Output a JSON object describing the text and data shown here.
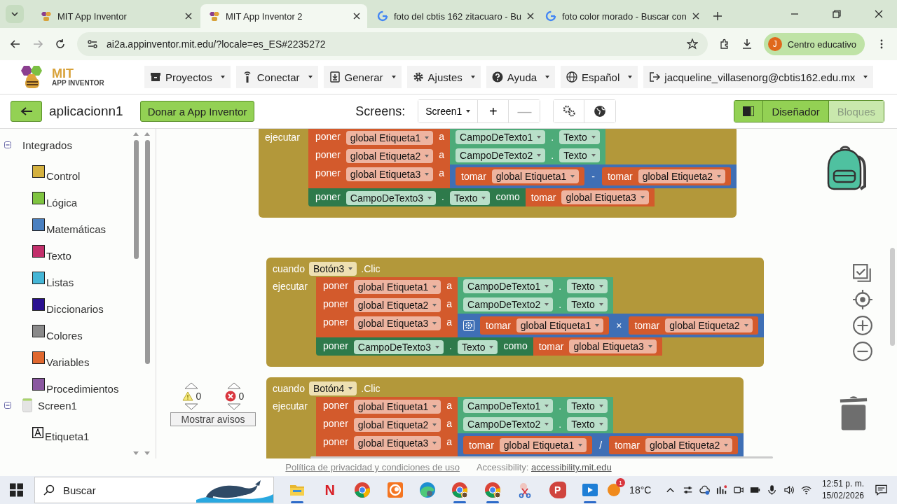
{
  "browser": {
    "tabs": [
      {
        "title": "MIT App Inventor",
        "selected": false
      },
      {
        "title": "MIT App Inventor 2",
        "selected": true
      },
      {
        "title": "foto del cbtis 162 zitacuaro - Bu",
        "selected": false
      },
      {
        "title": "foto color morado - Buscar con",
        "selected": false
      }
    ],
    "url": "ai2a.appinventor.mit.edu/?locale=es_ES#2235272",
    "profile": {
      "initial": "J",
      "name": "Centro educativo"
    }
  },
  "header": {
    "logo_title": "MIT",
    "logo_subtitle": "APP INVENTOR",
    "menus": [
      {
        "label": "Proyectos"
      },
      {
        "label": "Conectar"
      },
      {
        "label": "Generar"
      },
      {
        "label": "Ajustes"
      },
      {
        "label": "Ayuda"
      },
      {
        "label": "Español"
      },
      {
        "label": "jacqueline_villasenorg@cbtis162.edu.mx"
      }
    ]
  },
  "toolbar": {
    "project": "aplicacionn1",
    "donate": "Donar a App Inventor",
    "screens_label": "Screens:",
    "screen": "Screen1",
    "add": "+",
    "remove": "—",
    "views": [
      {
        "label": "Diseñador",
        "selected": false
      },
      {
        "label": "Bloques",
        "selected": true
      }
    ]
  },
  "sidebar": {
    "tree": [
      {
        "label": "Integrados",
        "kind": "group",
        "expanded": true,
        "children": [
          {
            "label": "Control",
            "kind": "category",
            "color": "#d4b13f"
          },
          {
            "label": "Lógica",
            "kind": "category",
            "color": "#7fc440"
          },
          {
            "label": "Matemáticas",
            "kind": "category",
            "color": "#4a80c0"
          },
          {
            "label": "Texto",
            "kind": "category",
            "color": "#c2306b"
          },
          {
            "label": "Listas",
            "kind": "category",
            "color": "#45b6d6"
          },
          {
            "label": "Diccionarios",
            "kind": "category",
            "color": "#2a1190"
          },
          {
            "label": "Colores",
            "kind": "category",
            "color": "#8a8a8a"
          },
          {
            "label": "Variables",
            "kind": "category",
            "color": "#e0682f"
          },
          {
            "label": "Procedimientos",
            "kind": "category",
            "color": "#8a58a0"
          }
        ]
      },
      {
        "label": "Screen1",
        "kind": "screen",
        "expanded": true,
        "children": [
          {
            "label": "Etiqueta1",
            "kind": "label"
          }
        ]
      }
    ]
  },
  "blocks": [
    {
      "label": "ejecutar",
      "statements": [
        {
          "kind": "set_global",
          "verb": "poner",
          "variable": "global Etiqueta1",
          "connector": "a",
          "value": {
            "kind": "property",
            "component": "CampoDeTexto1",
            "dot": ".",
            "property": "Texto"
          }
        },
        {
          "kind": "set_global",
          "verb": "poner",
          "variable": "global Etiqueta2",
          "connector": "a",
          "value": {
            "kind": "property",
            "component": "CampoDeTexto2",
            "dot": ".",
            "property": "Texto"
          }
        },
        {
          "kind": "set_global",
          "verb": "poner",
          "variable": "global Etiqueta3",
          "connector": "a",
          "value": {
            "kind": "math",
            "mutator": false,
            "operator": "-",
            "left": {
              "kind": "get",
              "verb": "tomar",
              "variable": "global Etiqueta1"
            },
            "right": {
              "kind": "get",
              "verb": "tomar",
              "variable": "global Etiqueta2"
            }
          }
        },
        {
          "kind": "set_property",
          "verb": "poner",
          "component": "CampoDeTexto3",
          "dot": ".",
          "property": "Texto",
          "connector": "como",
          "value": {
            "kind": "get",
            "verb": "tomar",
            "variable": "global Etiqueta3"
          }
        }
      ]
    },
    {
      "header": {
        "word": "cuando",
        "component": "Botón3",
        "event": ".Clic"
      },
      "label": "ejecutar",
      "statements": [
        {
          "kind": "set_global",
          "verb": "poner",
          "variable": "global Etiqueta1",
          "connector": "a",
          "value": {
            "kind": "property",
            "component": "CampoDeTexto1",
            "dot": ".",
            "property": "Texto"
          }
        },
        {
          "kind": "set_global",
          "verb": "poner",
          "variable": "global Etiqueta2",
          "connector": "a",
          "value": {
            "kind": "property",
            "component": "CampoDeTexto2",
            "dot": ".",
            "property": "Texto"
          }
        },
        {
          "kind": "set_global",
          "verb": "poner",
          "variable": "global Etiqueta3",
          "connector": "a",
          "value": {
            "kind": "math",
            "mutator": true,
            "operator": "×",
            "left": {
              "kind": "get",
              "verb": "tomar",
              "variable": "global Etiqueta1"
            },
            "right": {
              "kind": "get",
              "verb": "tomar",
              "variable": "global Etiqueta2"
            }
          }
        },
        {
          "kind": "set_property",
          "verb": "poner",
          "component": "CampoDeTexto3",
          "dot": ".",
          "property": "Texto",
          "connector": "como",
          "value": {
            "kind": "get",
            "verb": "tomar",
            "variable": "global Etiqueta3"
          }
        }
      ]
    },
    {
      "header": {
        "word": "cuando",
        "component": "Botón4",
        "event": ".Clic"
      },
      "label": "ejecutar",
      "statements": [
        {
          "kind": "set_global",
          "verb": "poner",
          "variable": "global Etiqueta1",
          "connector": "a",
          "value": {
            "kind": "property",
            "component": "CampoDeTexto1",
            "dot": ".",
            "property": "Texto"
          }
        },
        {
          "kind": "set_global",
          "verb": "poner",
          "variable": "global Etiqueta2",
          "connector": "a",
          "value": {
            "kind": "property",
            "component": "CampoDeTexto2",
            "dot": ".",
            "property": "Texto"
          }
        },
        {
          "kind": "set_global",
          "verb": "poner",
          "variable": "global Etiqueta3",
          "connector": "a",
          "value": {
            "kind": "math",
            "mutator": false,
            "operator": "/",
            "left": {
              "kind": "get",
              "verb": "tomar",
              "variable": "global Etiqueta1"
            },
            "right": {
              "kind": "get",
              "verb": "tomar",
              "variable": "global Etiqueta2"
            }
          }
        }
      ]
    }
  ],
  "warnings": {
    "warning_count": "0",
    "error_count": "0",
    "button": "Mostrar avisos"
  },
  "footer": {
    "privacy": "Política de privacidad y condiciones de uso",
    "accessibility_label": "Accessibility:",
    "accessibility_link": "accessibility.mit.edu"
  },
  "taskbar": {
    "search": "Buscar",
    "apps": [
      {
        "kind": "folder",
        "running": true
      },
      {
        "kind": "netflix",
        "glyph": "N",
        "running": false
      },
      {
        "kind": "chrome",
        "running": false
      },
      {
        "kind": "crunchyroll",
        "running": false
      },
      {
        "kind": "edge",
        "running": false
      },
      {
        "kind": "chrome",
        "running": true
      },
      {
        "kind": "chrome",
        "running": true
      },
      {
        "kind": "scissors",
        "running": false
      },
      {
        "kind": "slides",
        "glyph": "P",
        "running": false
      },
      {
        "kind": "player",
        "running": true
      }
    ],
    "weather_badge": "1",
    "temperature": "18°C",
    "time": "12:51 p. m.",
    "date": "15/02/2026"
  }
}
